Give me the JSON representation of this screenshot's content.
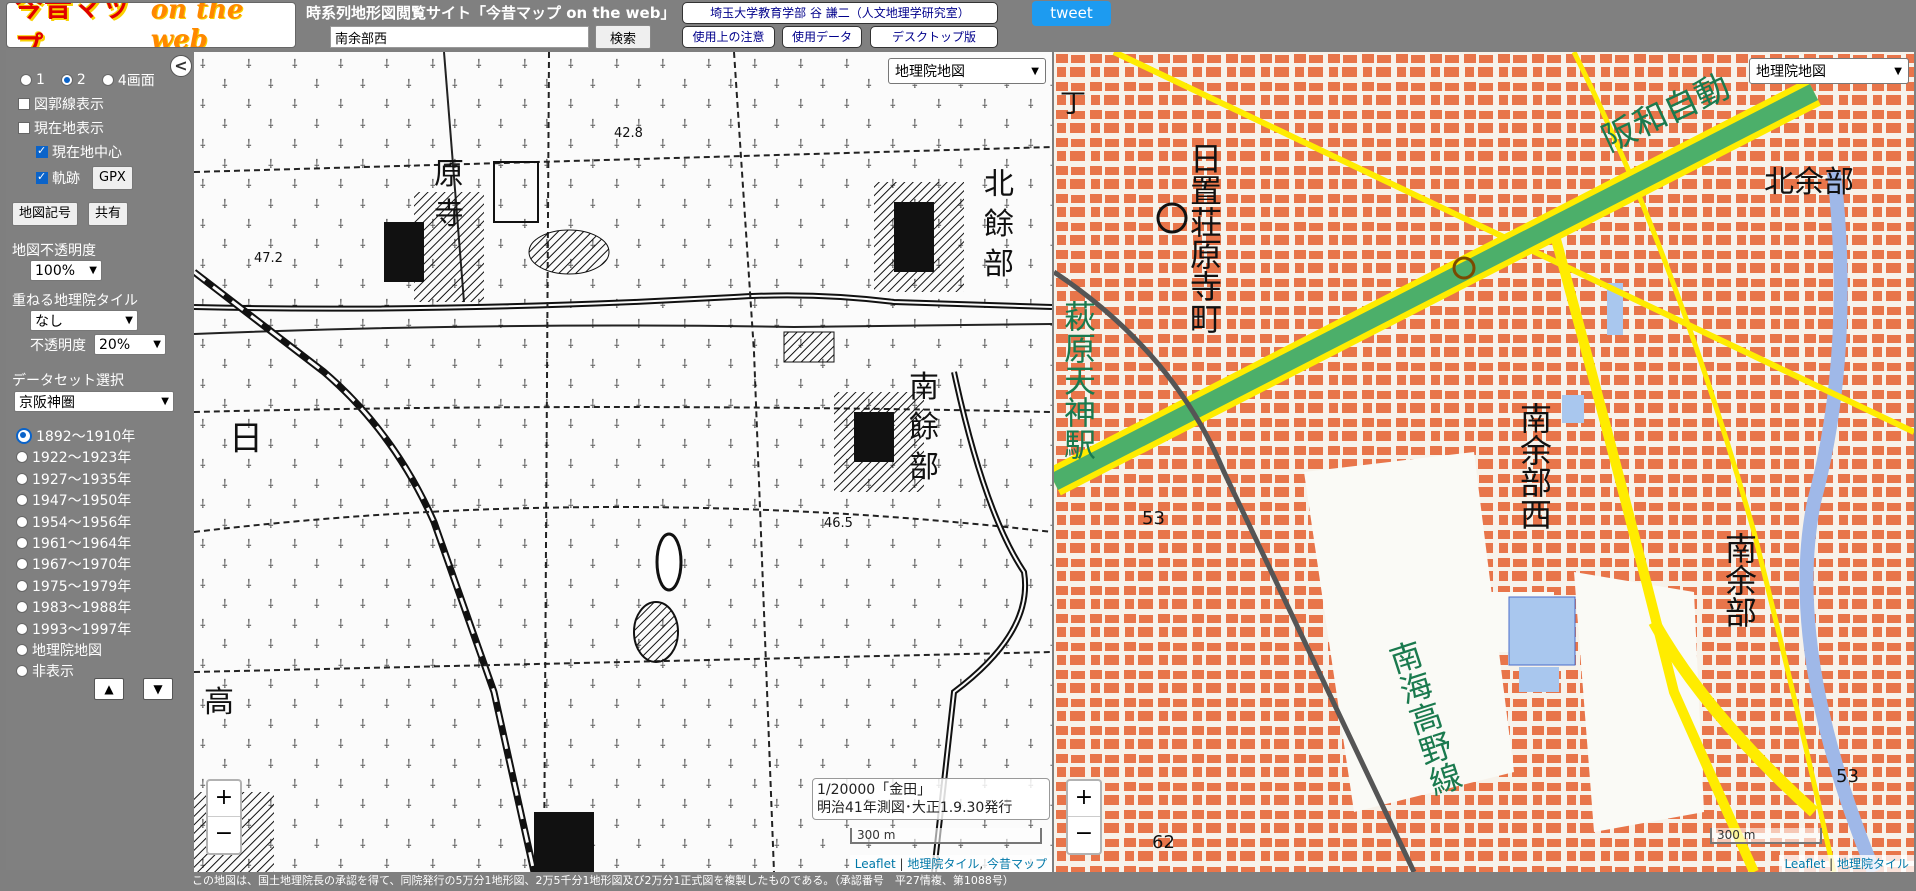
{
  "header": {
    "logo_main": "今昔マップ",
    "logo_sub": "on the web",
    "title": "時系列地形図閲覧サイト「今昔マップ on the web」",
    "search_value": "南余部西",
    "search_button": "検索",
    "univ_link": "埼玉大学教育学部 谷 謙二（人文地理学研究室）",
    "notes_link": "使用上の注意",
    "data_link": "使用データ",
    "desktop_link": "デスクトップ版",
    "tweet": "tweet"
  },
  "sidebar": {
    "collapse": "<",
    "screen_options": [
      "1",
      "2",
      "4画面"
    ],
    "selected_screen": "2",
    "grid_lines": "図郭線表示",
    "current_location": "現在地表示",
    "center_current": "現在地中心",
    "track": "軌跡",
    "gpx_button": "GPX",
    "legend_button": "地図記号",
    "share_button": "共有",
    "opacity_label": "地図不透明度",
    "opacity_value": "100%",
    "overlay_label": "重ねる地理院タイル",
    "overlay_value": "なし",
    "overlay_opacity_label": "不透明度",
    "overlay_opacity_value": "20%",
    "dataset_label": "データセット選択",
    "dataset_value": "京阪神圏",
    "periods": [
      "1892～1910年",
      "1922～1923年",
      "1927～1935年",
      "1947～1950年",
      "1954～1956年",
      "1961～1964年",
      "1967～1970年",
      "1975～1979年",
      "1983～1988年",
      "1993～1997年",
      "地理院地図",
      "非表示"
    ],
    "selected_period": 0,
    "up": "▲",
    "down": "▼"
  },
  "left_map": {
    "layer": "地理院地図",
    "info_line1": "1/20000「金田」",
    "info_line2": "明治41年測図･大正1.9.30発行",
    "scale": "300 m",
    "attribution": [
      "Leaflet",
      "地理院タイル",
      "今昔マップ"
    ],
    "labels": [
      "原",
      "寺",
      "北",
      "餘",
      "部",
      "南",
      "餘",
      "部",
      "日",
      "高"
    ],
    "elevations": [
      "42.8",
      "47.2",
      "46.5"
    ]
  },
  "right_map": {
    "layer": "地理院地図",
    "scale": "300 m",
    "attribution": [
      "Leaflet",
      "地理院タイル"
    ],
    "labels": {
      "hioki": "日置荘原寺町",
      "hanwa": "阪和自動",
      "kitaamabe": "北余部",
      "hagiwara": "萩原天神駅",
      "minamiamabe_nishi": "南余部西",
      "minamiamabe": "南余部",
      "nankai": "南海高野線",
      "cho": "丁"
    },
    "elevations": [
      "53",
      "53",
      "62"
    ]
  },
  "footer": "この地図は、国土地理院長の承認を得て、同院発行の5万分1地形図、2万5千分1地形図及び2万分1正式図を複製したものである。（承認番号　平27情複、第1088号）",
  "colors": {
    "background": "#7f7f7f",
    "tweet": "#1d9bf0",
    "road_yellow": "#ffec00",
    "expressway_green": "#4caf6a",
    "building_orange": "#e8754a"
  }
}
